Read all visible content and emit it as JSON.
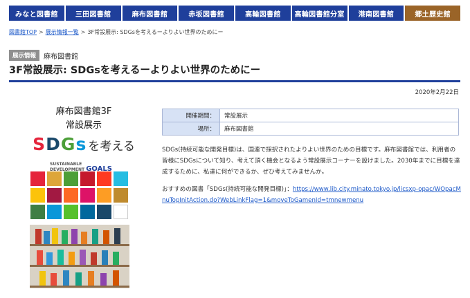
{
  "nav": {
    "items": [
      {
        "label": "みなと図書館",
        "accent": false
      },
      {
        "label": "三田図書館",
        "accent": false
      },
      {
        "label": "麻布図書館",
        "accent": false
      },
      {
        "label": "赤坂図書館",
        "accent": false
      },
      {
        "label": "高輪図書館",
        "accent": false
      },
      {
        "label": "高輪図書館分室",
        "accent": false
      },
      {
        "label": "港南図書館",
        "accent": false
      },
      {
        "label": "郷土歴史館",
        "accent": true
      }
    ]
  },
  "breadcrumb": {
    "home": "図書館TOP",
    "sep": ">",
    "list": "展示情報一覧",
    "current": "3F常設展示: SDGsを考えるーよりよい世界のためにー"
  },
  "article": {
    "category": "展示情報",
    "library": "麻布図書館",
    "title": "3F常設展示: SDGsを考えるーよりよい世界のためにー",
    "date": "2020年2月22日"
  },
  "poster": {
    "line1": "麻布図書館3F",
    "line2": "常設展示",
    "sdgs_letters": [
      "S",
      "D",
      "G",
      "s"
    ],
    "sdgs_colors": [
      "#e5243b",
      "#19486a",
      "#4c9f38",
      "#0a97d9"
    ],
    "sdgs_rest": "を考える",
    "goals_line1": "SUSTAINABLE",
    "goals_line2": "DEVELOPMENT",
    "goals_word": "GOALS",
    "tile_colors": [
      "#e5243b",
      "#dda63a",
      "#4c9f38",
      "#c5192d",
      "#ff3a21",
      "#26bde2",
      "#fcc30b",
      "#a21942",
      "#fd6925",
      "#dd1367",
      "#fd9d24",
      "#bf8b2e",
      "#3f7e44",
      "#0a97d9",
      "#56c02b",
      "#00689d",
      "#19486a",
      "#ffffff"
    ]
  },
  "info": {
    "period_label": "開催期間：",
    "period_value": "常設展示",
    "place_label": "場所：",
    "place_value": "麻布図書館"
  },
  "body": {
    "description": "SDGs(持続可能な開発目標)は、国連で採択されたよりよい世界のための目標です。麻布図書館では、利用者の皆様にSDGsについて知り、考えて頂く機会となるよう常設展示コーナーを設けました。2030年までに目標を達成するために、私達に何ができるか、ぜひ考えてみませんか。",
    "recommend_prefix": "おすすめの図書「SDGs(持続可能な開発目標)」：",
    "recommend_link": "https://www.lib.city.minato.tokyo.jp/licsxp-opac/WOpacMnuTopInitAction.do?WebLinkFlag=1&moveToGamenId=tmnewmenu"
  }
}
